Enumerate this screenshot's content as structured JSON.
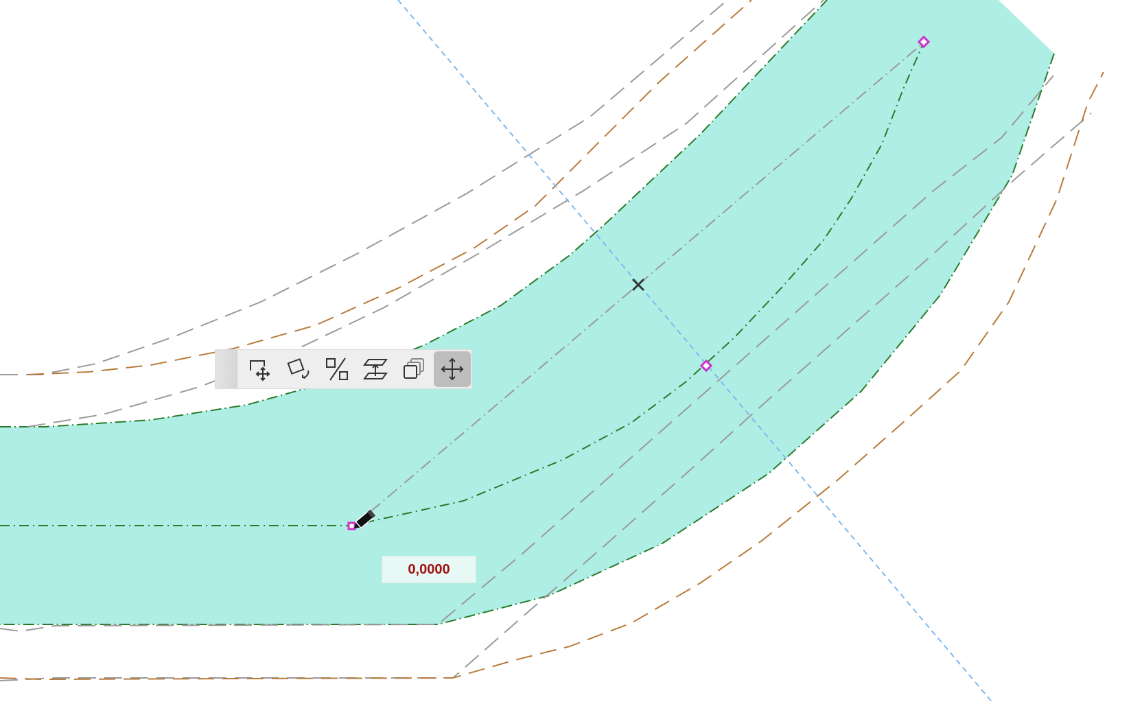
{
  "canvas": {
    "fill_color": "#aeeee4",
    "edge_color": "#2a7a2a",
    "guide_color": "#7fb8ee",
    "handle_color": "#cc33cc",
    "offset_line_color": "#b87a3a",
    "reference_line_color": "#9a9a9a"
  },
  "pet_palette": {
    "tools": [
      {
        "name": "drag-tool",
        "icon": "drag-icon",
        "active": false
      },
      {
        "name": "rotate-tool",
        "icon": "rotate-icon",
        "active": false
      },
      {
        "name": "mirror-tool",
        "icon": "mirror-icon",
        "active": false
      },
      {
        "name": "elevate-tool",
        "icon": "elevate-icon",
        "active": false
      },
      {
        "name": "multiply-tool",
        "icon": "multiply-icon",
        "active": false
      },
      {
        "name": "move-node-tool",
        "icon": "move-icon",
        "active": true
      }
    ]
  },
  "tracker": {
    "value": "0,0000"
  }
}
